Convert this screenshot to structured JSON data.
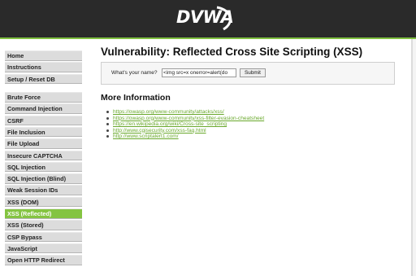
{
  "header": {
    "logo_text": "DVWA",
    "accent_color": "#84c441",
    "header_color": "#2a2a2a"
  },
  "sidebar": {
    "groups": [
      {
        "items": [
          {
            "label": "Home"
          },
          {
            "label": "Instructions"
          },
          {
            "label": "Setup / Reset DB"
          }
        ]
      },
      {
        "items": [
          {
            "label": "Brute Force"
          },
          {
            "label": "Command Injection"
          },
          {
            "label": "CSRF"
          },
          {
            "label": "File Inclusion"
          },
          {
            "label": "File Upload"
          },
          {
            "label": "Insecure CAPTCHA"
          },
          {
            "label": "SQL Injection"
          },
          {
            "label": "SQL Injection (Blind)"
          },
          {
            "label": "Weak Session IDs"
          },
          {
            "label": "XSS (DOM)"
          },
          {
            "label": "XSS (Reflected)",
            "selected": true
          },
          {
            "label": "XSS (Stored)"
          },
          {
            "label": "CSP Bypass"
          },
          {
            "label": "JavaScript"
          },
          {
            "label": "Open HTTP Redirect"
          }
        ]
      }
    ]
  },
  "main": {
    "title": "Vulnerability: Reflected Cross Site Scripting (XSS)",
    "form": {
      "label": "What's your name?",
      "input_value": "<img src=x onerror=alert(do",
      "submit_label": "Submit"
    },
    "more_info": {
      "heading": "More Information",
      "links": [
        "https://owasp.org/www-community/attacks/xss/",
        "https://owasp.org/www-community/xss-filter-evasion-cheatsheet",
        "https://en.wikipedia.org/wiki/Cross-site_scripting",
        "http://www.cgisecurity.com/xss-faq.html",
        "http://www.scriptalert1.com/"
      ]
    }
  }
}
